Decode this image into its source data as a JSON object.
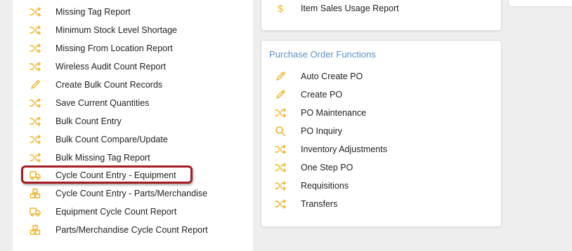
{
  "left_menu": {
    "items": [
      {
        "label": "Missing Tag Report",
        "icon": "shuffle-icon"
      },
      {
        "label": "Minimum Stock Level Shortage",
        "icon": "shuffle-icon"
      },
      {
        "label": "Missing From Location Report",
        "icon": "shuffle-icon"
      },
      {
        "label": "Wireless Audit Count Report",
        "icon": "shuffle-icon"
      },
      {
        "label": "Create Bulk Count Records",
        "icon": "pencil-icon"
      },
      {
        "label": "Save Current Quantities",
        "icon": "shuffle-icon"
      },
      {
        "label": "Bulk Count Entry",
        "icon": "shuffle-icon"
      },
      {
        "label": "Bulk Count Compare/Update",
        "icon": "shuffle-icon"
      },
      {
        "label": "Bulk Missing Tag Report",
        "icon": "shuffle-icon"
      },
      {
        "label": "Cycle Count Entry - Equipment",
        "icon": "truck-icon",
        "highlighted": true
      },
      {
        "label": "Cycle Count Entry - Parts/Merchandise",
        "icon": "boxes-icon"
      },
      {
        "label": "Equipment Cycle Count Report",
        "icon": "truck-icon"
      },
      {
        "label": "Parts/Merchandise Cycle Count Report",
        "icon": "boxes-icon"
      }
    ]
  },
  "top_card": {
    "items": [
      {
        "label": "Item Sales Usage Report",
        "icon": "dollar-icon"
      }
    ]
  },
  "po_card": {
    "title": "Purchase Order Functions",
    "items": [
      {
        "label": "Auto Create PO",
        "icon": "pencil-icon"
      },
      {
        "label": "Create PO",
        "icon": "pencil-icon"
      },
      {
        "label": "PO Maintenance",
        "icon": "shuffle-icon"
      },
      {
        "label": "PO Inquiry",
        "icon": "search-icon"
      },
      {
        "label": "Inventory Adjustments",
        "icon": "shuffle-icon"
      },
      {
        "label": "One Step PO",
        "icon": "shuffle-icon"
      },
      {
        "label": "Requisitions",
        "icon": "shuffle-icon"
      },
      {
        "label": "Transfers",
        "icon": "shuffle-icon"
      }
    ]
  },
  "colors": {
    "icon": "#f0b323",
    "card_title": "#5b8fc8",
    "highlight": "#a51c24"
  }
}
